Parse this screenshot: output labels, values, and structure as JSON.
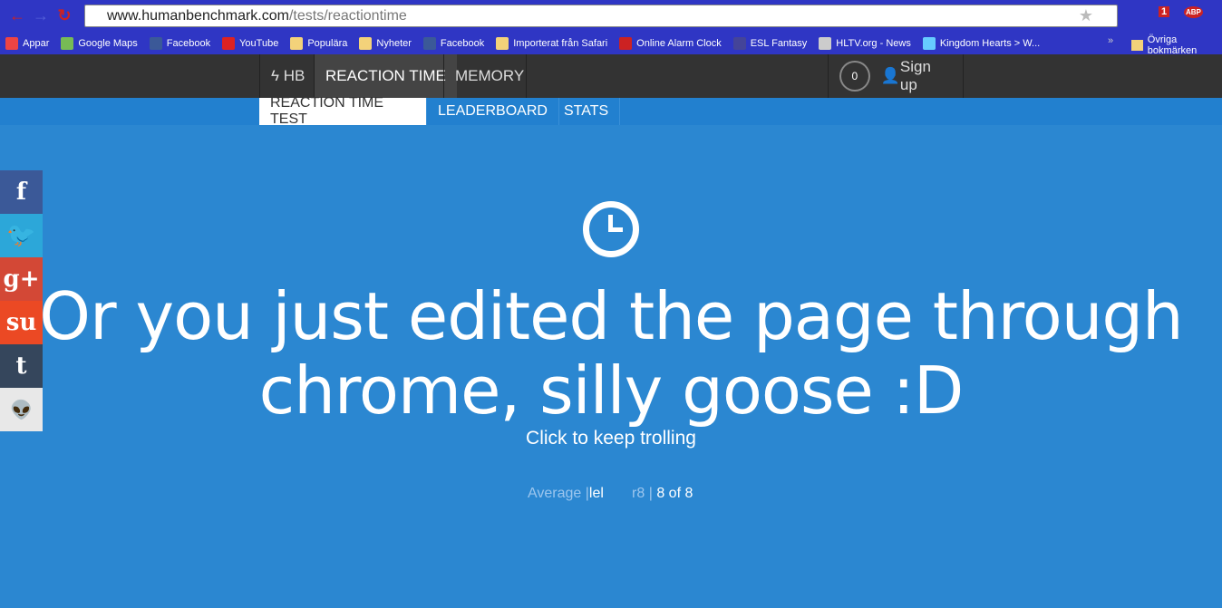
{
  "browser": {
    "url_host": "www.humanbenchmark.com",
    "url_path": "/tests/reactiontime",
    "bookmarks": [
      {
        "label": "Appar",
        "color": "#e44"
      },
      {
        "label": "Google Maps",
        "color": "#7b5"
      },
      {
        "label": "Facebook",
        "color": "#3b5998"
      },
      {
        "label": "YouTube",
        "color": "#d22"
      },
      {
        "label": "Populära",
        "color": "#f3d27a"
      },
      {
        "label": "Nyheter",
        "color": "#f3d27a"
      },
      {
        "label": "Facebook",
        "color": "#3b5998"
      },
      {
        "label": "Importerat från Safari",
        "color": "#f3d27a"
      },
      {
        "label": "Online Alarm Clock",
        "color": "#c22"
      },
      {
        "label": "ESL Fantasy",
        "color": "#449"
      },
      {
        "label": "HLTV.org - News",
        "color": "#ccc"
      },
      {
        "label": "Kingdom Hearts > W...",
        "color": "#6cf"
      }
    ],
    "overflow": "»",
    "other_bookmarks": "Övriga bokmärken",
    "gmail_badge": "1",
    "abp_badge": "1",
    "abp_label": "ABP"
  },
  "nav": {
    "logo": "HB",
    "items": [
      "REACTION TIME",
      "MEMORY"
    ],
    "score": "0",
    "signup": "Sign up"
  },
  "subnav": [
    "REACTION TIME TEST",
    "LEADERBOARD",
    "STATS"
  ],
  "social": [
    {
      "name": "facebook",
      "glyph": "f",
      "color": "#3b5998"
    },
    {
      "name": "twitter",
      "glyph": "🐦",
      "color": "#2ca7d9"
    },
    {
      "name": "google-plus",
      "glyph": "g+",
      "color": "#d34836"
    },
    {
      "name": "stumbleupon",
      "glyph": "su",
      "color": "#eb4924"
    },
    {
      "name": "tumblr",
      "glyph": "t",
      "color": "#35465c"
    },
    {
      "name": "reddit",
      "glyph": "👽",
      "color": "#e8e8e8"
    }
  ],
  "main": {
    "headline_line1": "Or you just edited the page through",
    "headline_line2": "chrome, silly goose :D",
    "cta": "Click to keep trolling",
    "avg_label": "Average |",
    "avg_value": "lel",
    "round_label": "r8 |",
    "round_value": "8 of 8"
  }
}
